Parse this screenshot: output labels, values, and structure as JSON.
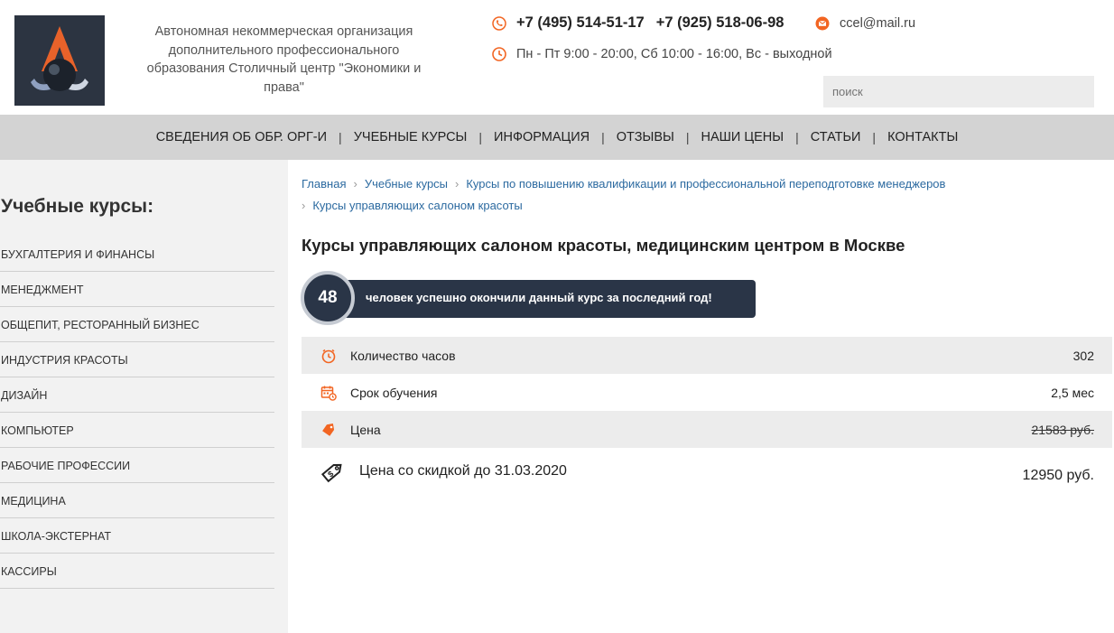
{
  "header": {
    "org_name": "Автономная некоммерческая организация дополнительного профессионального образования Столичный центр \"Экономики и права\"",
    "phone_1": "+7 (495) 514-51-17",
    "phone_2": "+7 (925) 518-06-98",
    "hours": "Пн - Пт 9:00 - 20:00, Сб 10:00 - 16:00, Вс - выходной",
    "email": "ccel@mail.ru",
    "search_placeholder": "поиск",
    "icons": {
      "phone": "phone-icon",
      "clock": "clock-icon",
      "mail": "mail-icon"
    },
    "accent_color": "#f26522"
  },
  "nav": {
    "items": [
      "СВЕДЕНИЯ ОБ ОБР. ОРГ-И",
      "УЧЕБНЫЕ КУРСЫ",
      "ИНФОРМАЦИЯ",
      "ОТЗЫВЫ",
      "НАШИ ЦЕНЫ",
      "СТАТЬИ",
      "КОНТАКТЫ"
    ],
    "separator": "|"
  },
  "sidebar": {
    "title": "Учебные курсы:",
    "items": [
      "БУХГАЛТЕРИЯ И ФИНАНСЫ",
      "МЕНЕДЖМЕНТ",
      "ОБЩЕПИТ, РЕСТОРАННЫЙ БИЗНЕС",
      "ИНДУСТРИЯ КРАСОТЫ",
      "ДИЗАЙН",
      "КОМПЬЮТЕР",
      "РАБОЧИЕ ПРОФЕССИИ",
      "МЕДИЦИНА",
      "ШКОЛА-ЭКСТЕРНАТ",
      "КАССИРЫ"
    ]
  },
  "breadcrumb": {
    "items": [
      "Главная",
      "Учебные курсы",
      "Курсы по повышению квалификации и профессиональной переподготовке менеджеров",
      "Курсы управляющих салоном красоты"
    ],
    "separator": "›"
  },
  "main": {
    "title": "Курсы управляющих салоном красоты, медицинским центром в Москве",
    "graduates_count": "48",
    "graduates_text": "человек успешно окончили данный курс за последний год!",
    "rows": [
      {
        "icon": "clock-icon",
        "label": "Количество часов",
        "value": "302"
      },
      {
        "icon": "calendar-icon",
        "label": "Срок обучения",
        "value": "2,5 мес"
      },
      {
        "icon": "price-tag-icon",
        "label": "Цена",
        "value": "21583 руб."
      },
      {
        "icon": "discount-tag-icon",
        "label": "Цена со скидкой до 31.03.2020",
        "value": "12950 руб."
      }
    ]
  }
}
